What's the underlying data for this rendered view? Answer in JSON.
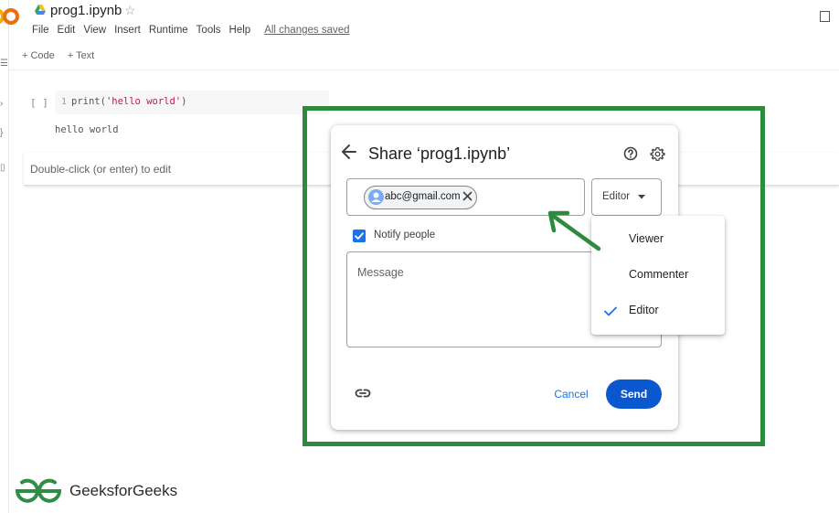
{
  "app": {
    "notebook_title": "prog1.ipynb",
    "menu": [
      "File",
      "Edit",
      "View",
      "Insert",
      "Runtime",
      "Tools",
      "Help"
    ],
    "save_status": "All changes saved",
    "toolbar": {
      "add_code": "+ Code",
      "add_text": "+ Text"
    }
  },
  "notebook": {
    "code_cell": {
      "bracket": "[ ]",
      "line_number": "1",
      "code_fn": "print(",
      "code_str": "'hello world'",
      "code_end": ")",
      "output": "hello world"
    },
    "text_cell_placeholder": "Double-click (or enter) to edit"
  },
  "share_dialog": {
    "title": "Share ‘prog1.ipynb’",
    "recipient_email": "abc@gmail.com",
    "role_selected": "Editor",
    "notify_label": "Notify people",
    "notify_checked": true,
    "message_placeholder": "Message",
    "cancel_label": "Cancel",
    "send_label": "Send",
    "role_options": [
      "Viewer",
      "Commenter",
      "Editor"
    ]
  },
  "watermark": {
    "brand": "GeeksforGeeks"
  },
  "colors": {
    "frame_green": "#2e8b3e",
    "accent_blue": "#1a73e8",
    "send_blue": "#0b57d0",
    "gfg_green": "#2f8d46"
  },
  "icons": [
    "colab-logo-icon",
    "drive-icon",
    "star-icon",
    "back-arrow-icon",
    "help-icon",
    "settings-icon",
    "avatar-icon",
    "close-icon",
    "caret-down-icon",
    "checkbox-icon",
    "link-icon",
    "check-icon",
    "annotation-arrow-icon",
    "gfg-logo-icon"
  ]
}
